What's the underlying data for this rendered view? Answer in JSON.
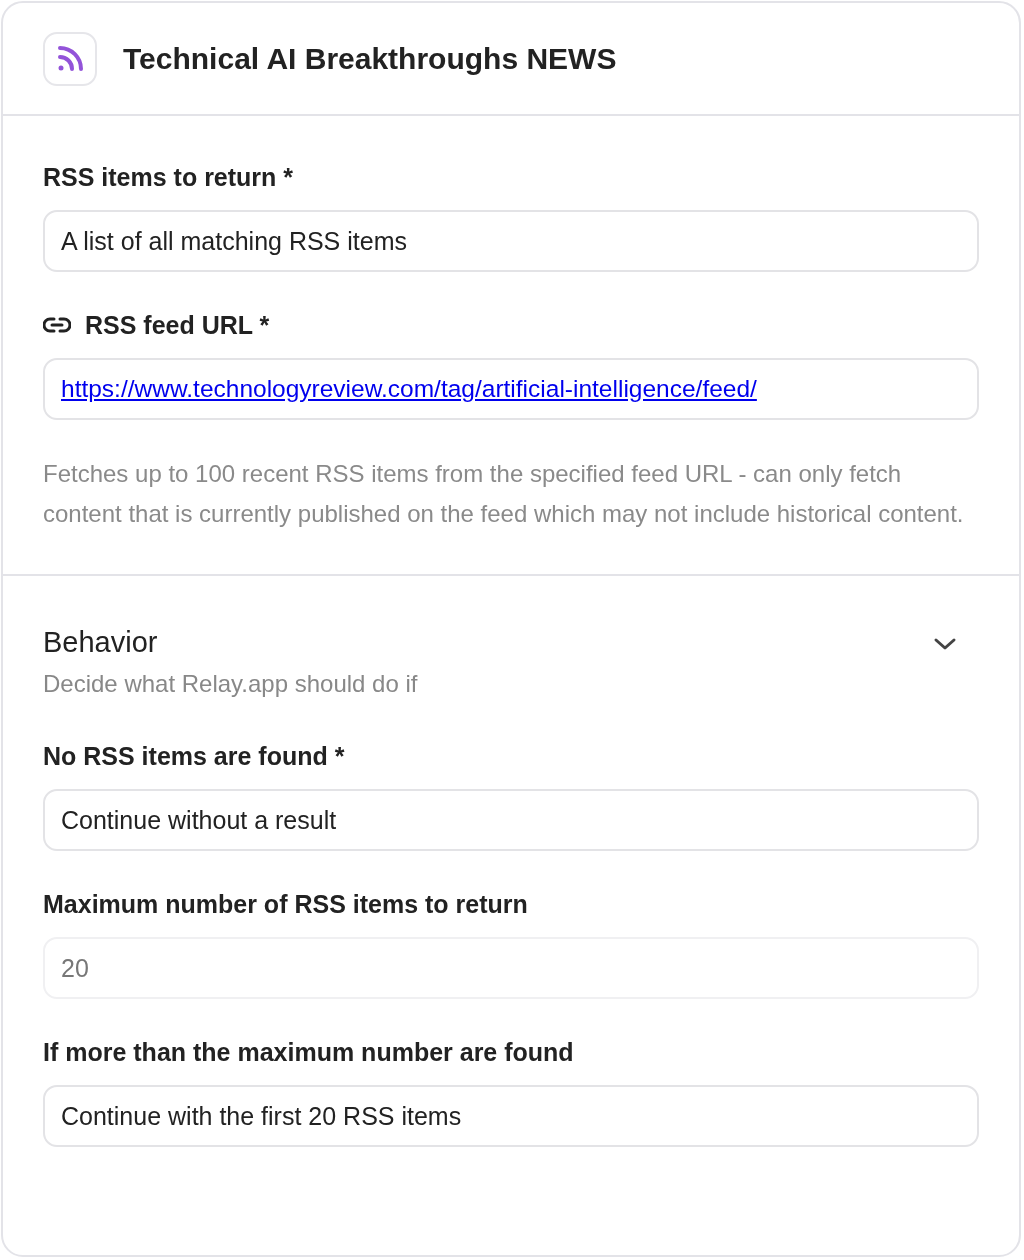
{
  "header": {
    "title": "Technical AI Breakthroughs NEWS"
  },
  "fields": [
    {
      "kind": "text",
      "label": "RSS items to return *",
      "value": "A list of all matching RSS items"
    },
    {
      "kind": "link",
      "label": "RSS feed URL *",
      "value": "https://www.technologyreview.com/tag/artificial-intelligence/feed/"
    }
  ],
  "description": "Fetches up to 100 recent RSS items from the specified feed URL - can only fetch content that is currently published on the feed which may not include historical content.",
  "behavior": {
    "title": "Behavior",
    "subtitle": "Decide what Relay.app should do if",
    "expanded": true,
    "fields": [
      {
        "kind": "text",
        "label": "No RSS items are found *",
        "value": "Continue without a result"
      },
      {
        "kind": "number",
        "label": "Maximum number of RSS items to return",
        "placeholder": "20"
      },
      {
        "kind": "text",
        "label": "If more than the maximum number are found",
        "value": "Continue with the first 20 RSS items"
      }
    ]
  }
}
